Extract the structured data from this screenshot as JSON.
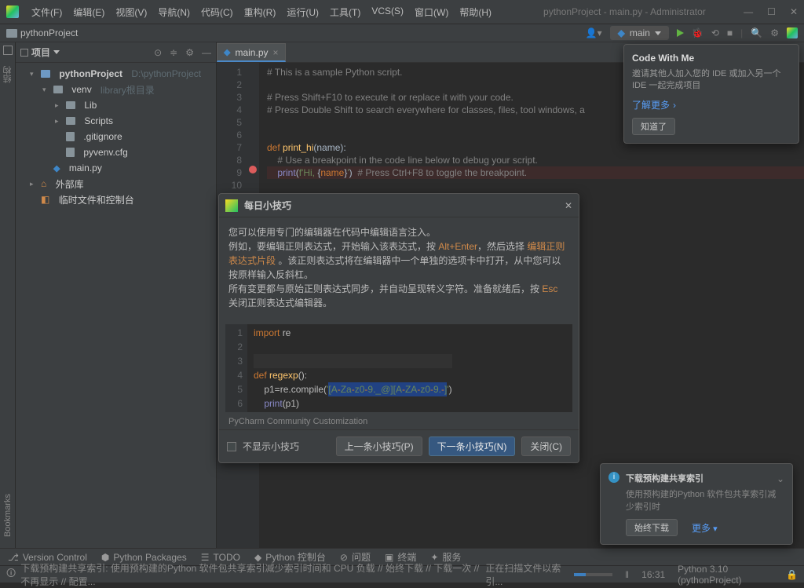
{
  "titlebar": {
    "menus": [
      "文件(F)",
      "编辑(E)",
      "视图(V)",
      "导航(N)",
      "代码(C)",
      "重构(R)",
      "运行(U)",
      "工具(T)",
      "VCS(S)",
      "窗口(W)",
      "帮助(H)"
    ],
    "title": "pythonProject - main.py - Administrator"
  },
  "breadcrumb": {
    "project": "pythonProject",
    "run_config": "main"
  },
  "left_gutter": {
    "structure": "结构",
    "bookmarks": "Bookmarks"
  },
  "project": {
    "label": "项目",
    "root": "pythonProject",
    "root_path": "D:\\pythonProject",
    "venv": "venv",
    "venv_note": "library根目录",
    "lib": "Lib",
    "scripts": "Scripts",
    "gitignore": ".gitignore",
    "pyvenv": "pyvenv.cfg",
    "mainpy": "main.py",
    "ext_libs": "外部库",
    "scratch": "临时文件和控制台"
  },
  "editor": {
    "tab": "main.py",
    "lines": [
      "# This is a sample Python script.",
      "",
      "# Press Shift+F10 to execute it or replace it with your code.",
      "# Press Double Shift to search everywhere for classes, files, tool windows, a",
      "",
      "",
      "def print_hi(name):",
      "    # Use a breakpoint in the code line below to debug your script.",
      "    print(f'Hi, {name}')  # Press Ctrl+F8 to toggle the breakpoint.",
      "",
      ""
    ]
  },
  "cwme": {
    "title": "Code With Me",
    "desc": "邀请其他人加入您的 IDE 或加入另一个 IDE 一起完成项目",
    "link": "了解更多",
    "btn": "知道了"
  },
  "tips": {
    "title": "每日小技巧",
    "p1a": "您可以使用专门的编辑器在代码中编辑语言注入。",
    "p2a": "例如，要编辑正则表达式，开始输入该表达式，按 ",
    "p2b": "Alt+Enter",
    "p2c": "，然后选择 ",
    "p2d": "编辑正则表达式片段",
    "p2e": " 。该正则表达式将在编辑器中一个单独的选项卡中打开，从中您可以按原样输入反斜杠。",
    "p3a": "所有变更都与原始正则表达式同步，并自动呈现转义字符。准备就绪后，按 ",
    "p3b": "Esc",
    "p3c": " 关闭正则表达式编辑器。",
    "code_note": "PyCharm Community Customization",
    "chk_label": "不显示小技巧",
    "btn_prev": "上一条小技巧(P)",
    "btn_next": "下一条小技巧(N)",
    "btn_close": "关闭(C)"
  },
  "notify": {
    "title": "下载预构建共享索引",
    "desc": "使用预构建的Python 软件包共享索引减少索引时",
    "btn": "始终下载",
    "link": "更多"
  },
  "bottom_tools": {
    "vcs": "Version Control",
    "pkg": "Python Packages",
    "todo": "TODO",
    "console": "Python 控制台",
    "problems": "问题",
    "terminal": "终端",
    "services": "服务"
  },
  "status": {
    "left": "下载预构建共享索引: 使用预构建的Python 软件包共享索引减少索引时间和 CPU 负载 // 始终下载 // 下载一次 // 不再显示 // 配置...",
    "indexing": "正在扫描文件以索引...",
    "pos": "16:31",
    "interp": "Python 3.10 (pythonProject)"
  }
}
